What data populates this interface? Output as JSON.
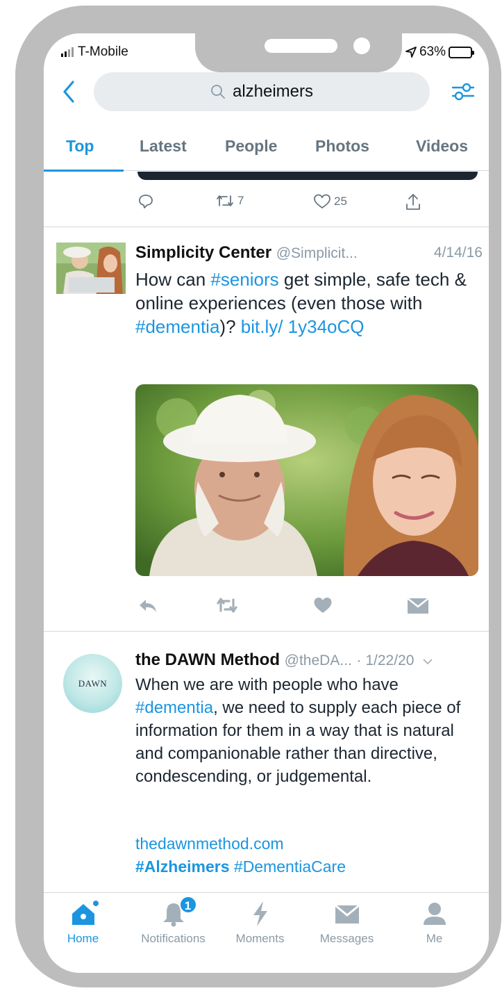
{
  "status_bar": {
    "carrier": "T-Mobile",
    "battery": "63%",
    "battery_level": 0.63
  },
  "search": {
    "query": "alzheimers"
  },
  "tabs": [
    {
      "label": "Top",
      "active": true
    },
    {
      "label": "Latest",
      "active": false
    },
    {
      "label": "People",
      "active": false
    },
    {
      "label": "Photos",
      "active": false
    },
    {
      "label": "Videos",
      "active": false
    }
  ],
  "prev_tweet": {
    "retweets": "7",
    "likes": "25"
  },
  "tweet1": {
    "author": "Simplicity Center",
    "handle": "@Simplicit...",
    "date": "4/14/16",
    "text_parts": [
      "How can ",
      "#seniors",
      " get simple, safe tech & online experiences (even those with ",
      "#dementia",
      ")? ",
      "bit.ly/ 1y34oCQ"
    ]
  },
  "tweet2": {
    "author": "the DAWN Method",
    "handle": "@theDA...",
    "date": "· 1/22/20",
    "avatar_text": "DAWN",
    "text_before": "When we are with people who have ",
    "hashtag": "#dementia",
    "text_after": ", we need to supply each piece of information for them in a way that is natural and companionable rather than directive, condescending, or judgemental.",
    "link": "thedawnmethod.com",
    "hashtag_bold": "#Alzheimers",
    "hashtag_last": "#DementiaCare"
  },
  "bottom_nav": [
    {
      "label": "Home",
      "active": true
    },
    {
      "label": "Notifications",
      "badge": "1"
    },
    {
      "label": "Moments"
    },
    {
      "label": "Messages"
    },
    {
      "label": "Me"
    }
  ],
  "colors": {
    "accent": "#1b95e0",
    "frame": "#bdbdbd",
    "muted": "#8a9aa6"
  }
}
